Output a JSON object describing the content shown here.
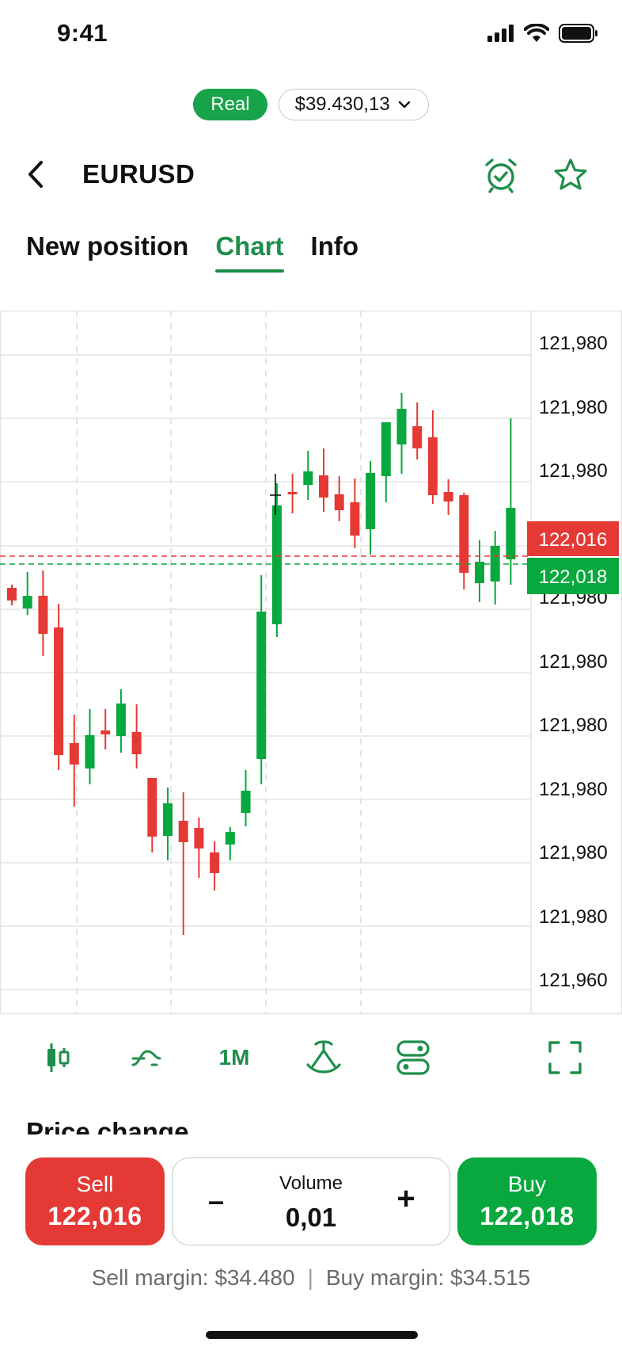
{
  "status_bar": {
    "time": "9:41",
    "icons": [
      "signal-icon",
      "wifi-icon",
      "battery-icon"
    ]
  },
  "account": {
    "mode": "Real",
    "balance": "$39.430,13"
  },
  "header": {
    "symbol": "EURUSD",
    "icons": [
      "back-icon",
      "alarm-icon",
      "star-icon"
    ]
  },
  "tabs": [
    {
      "label": "New position",
      "active": false
    },
    {
      "label": "Chart",
      "active": true
    },
    {
      "label": "Info",
      "active": false
    }
  ],
  "chart_data": {
    "type": "candlestick",
    "y_tick_labels": [
      "121,980",
      "121,980",
      "121,980",
      "121,980",
      "121,980",
      "121,980",
      "121,980",
      "121,980",
      "121,980",
      "121,960"
    ],
    "price_tags": {
      "sell": {
        "label": "122,016",
        "color": "#e53935"
      },
      "buy": {
        "label": "122,018",
        "color": "#07a83d"
      }
    },
    "colors": {
      "up": "#07a83d",
      "down": "#e53935",
      "grid": "#e3e3e3"
    },
    "candles": [
      {
        "o": 742,
        "c": 758,
        "h": 738,
        "l": 764
      },
      {
        "o": 768,
        "c": 752,
        "h": 722,
        "l": 776
      },
      {
        "o": 752,
        "c": 800,
        "h": 720,
        "l": 828
      },
      {
        "o": 792,
        "c": 953,
        "h": 762,
        "l": 972
      },
      {
        "o": 938,
        "c": 965,
        "h": 902,
        "l": 1018
      },
      {
        "o": 970,
        "c": 928,
        "h": 895,
        "l": 990
      },
      {
        "o": 922,
        "c": 927,
        "h": 895,
        "l": 946
      },
      {
        "o": 929,
        "c": 888,
        "h": 870,
        "l": 950
      },
      {
        "o": 924,
        "c": 952,
        "h": 889,
        "l": 970
      },
      {
        "o": 982,
        "c": 1056,
        "h": 982,
        "l": 1076
      },
      {
        "o": 1055,
        "c": 1014,
        "h": 994,
        "l": 1086
      },
      {
        "o": 1036,
        "c": 1063,
        "h": 1000,
        "l": 1180
      },
      {
        "o": 1045,
        "c": 1071,
        "h": 1032,
        "l": 1108
      },
      {
        "o": 1076,
        "c": 1102,
        "h": 1062,
        "l": 1124
      },
      {
        "o": 1066,
        "c": 1050,
        "h": 1044,
        "l": 1086
      },
      {
        "o": 1026,
        "c": 998,
        "h": 972,
        "l": 1043
      },
      {
        "o": 958,
        "c": 772,
        "h": 726,
        "l": 990
      },
      {
        "o": 788,
        "c": 638,
        "h": 610,
        "l": 804
      },
      {
        "o": 621,
        "c": 621,
        "h": 598,
        "l": 648
      },
      {
        "o": 612,
        "c": 595,
        "h": 569,
        "l": 631
      },
      {
        "o": 600,
        "c": 628,
        "h": 566,
        "l": 646
      },
      {
        "o": 624,
        "c": 644,
        "h": 601,
        "l": 658
      },
      {
        "o": 634,
        "c": 676,
        "h": 604,
        "l": 692
      },
      {
        "o": 668,
        "c": 597,
        "h": 582,
        "l": 700
      },
      {
        "o": 601,
        "c": 533,
        "h": 533,
        "l": 634
      },
      {
        "o": 561,
        "c": 516,
        "h": 496,
        "l": 598
      },
      {
        "o": 538,
        "c": 566,
        "h": 508,
        "l": 580
      },
      {
        "o": 552,
        "c": 625,
        "h": 518,
        "l": 636
      },
      {
        "o": 621,
        "c": 633,
        "h": 605,
        "l": 650
      },
      {
        "o": 625,
        "c": 723,
        "h": 622,
        "l": 744
      },
      {
        "o": 736,
        "c": 709,
        "h": 682,
        "l": 760
      },
      {
        "o": 734,
        "c": 689,
        "h": 670,
        "l": 763
      },
      {
        "o": 706,
        "c": 641,
        "h": 528,
        "l": 738
      }
    ]
  },
  "toolbar": {
    "items": [
      "candlestick-icon",
      "indicators-icon",
      "timeframe",
      "drawing-tools-icon",
      "toggle-icon",
      "fullscreen-icon"
    ],
    "timeframe_label": "1M"
  },
  "price_change": {
    "title": "Price change"
  },
  "trade": {
    "sell_label": "Sell",
    "sell_price": "122,016",
    "buy_label": "Buy",
    "buy_price": "122,018",
    "volume_label": "Volume",
    "volume_value": "0,01",
    "minus": "–",
    "plus": "+"
  },
  "margins": {
    "sell_margin": "Sell margin: $34.480",
    "separator": "|",
    "buy_margin": "Buy margin: $34.515"
  }
}
